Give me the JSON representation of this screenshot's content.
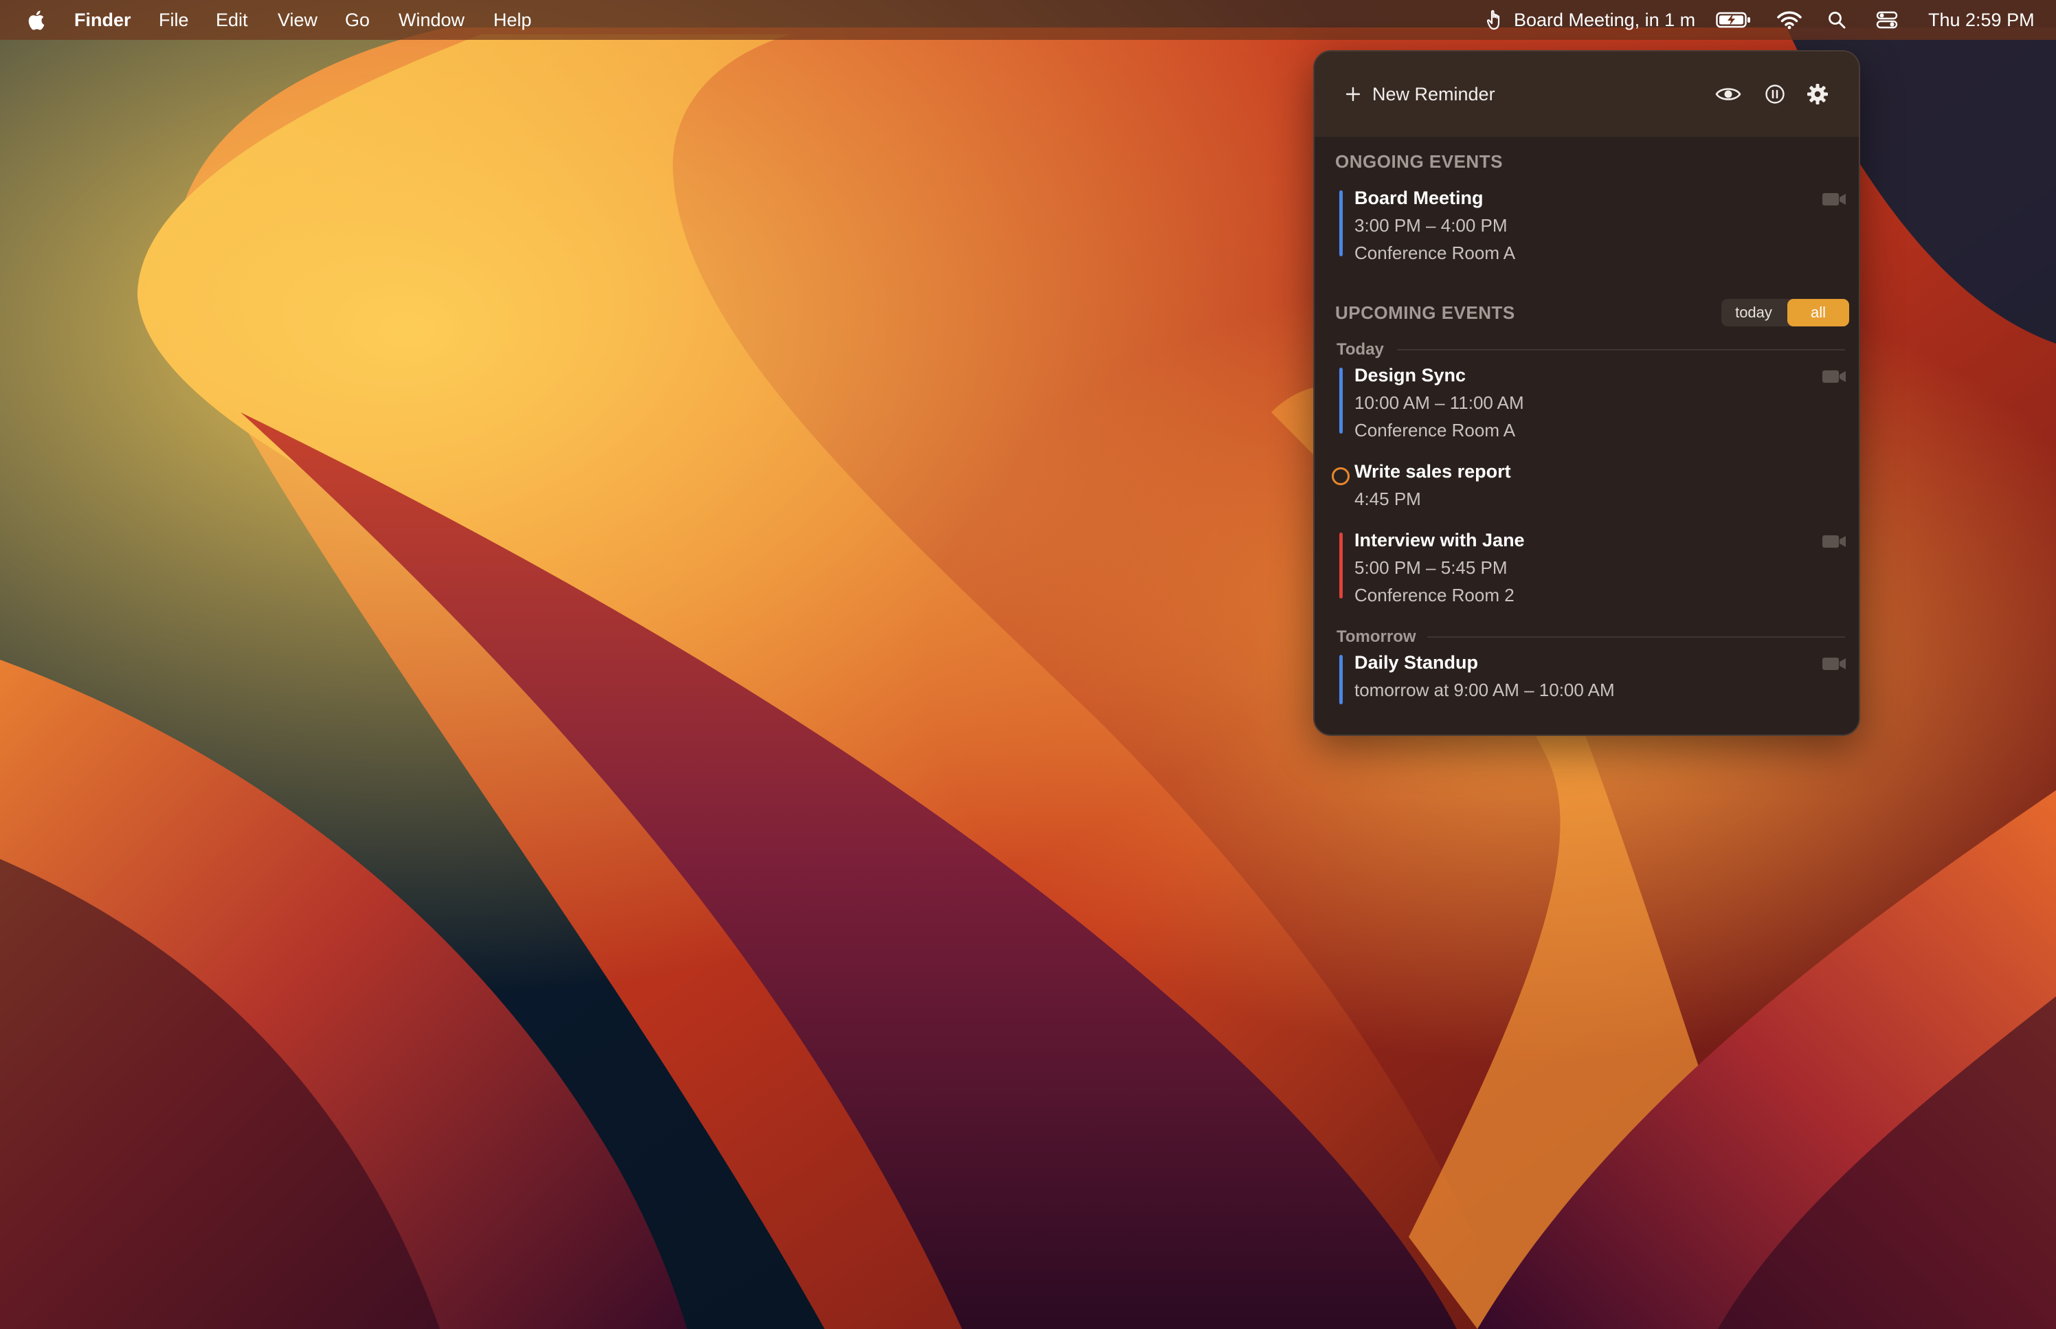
{
  "menubar": {
    "app_name": "Finder",
    "menus": [
      "File",
      "Edit",
      "View",
      "Go",
      "Window",
      "Help"
    ],
    "status_meeting": "Board Meeting, in 1 m",
    "clock": "Thu 2:59 PM",
    "icons": [
      "apple-icon",
      "hand-icon",
      "battery-charging-icon",
      "wifi-icon",
      "search-icon",
      "control-center-icon"
    ]
  },
  "panel": {
    "new_reminder_label": "New Reminder",
    "header_icons": [
      "plus-icon",
      "eye-icon",
      "pause-icon",
      "gear-icon"
    ],
    "ongoing_title": "ONGOING EVENTS",
    "ongoing": [
      {
        "title": "Board Meeting",
        "time": "3:00 PM – 4:00 PM",
        "location": "Conference Room A",
        "color": "#4a86e8"
      }
    ],
    "upcoming_title": "UPCOMING EVENTS",
    "filter": {
      "today": "today",
      "all": "all",
      "selected": "all"
    },
    "days": [
      {
        "label": "Today",
        "items": [
          {
            "kind": "event",
            "title": "Design Sync",
            "time": "10:00 AM – 11:00 AM",
            "location": "Conference Room A",
            "color": "#4a86e8"
          },
          {
            "kind": "reminder",
            "title": "Write sales report",
            "time": "4:45 PM",
            "color": "#e8872e"
          },
          {
            "kind": "event",
            "title": "Interview with Jane",
            "time": "5:00 PM – 5:45 PM",
            "location": "Conference Room 2",
            "color": "#e0413a"
          }
        ]
      },
      {
        "label": "Tomorrow",
        "items": [
          {
            "kind": "event",
            "title": "Daily Standup",
            "time": "tomorrow at 9:00 AM – 10:00 AM",
            "color": "#4a86e8"
          }
        ]
      }
    ],
    "accent_color": "#e7a032"
  }
}
